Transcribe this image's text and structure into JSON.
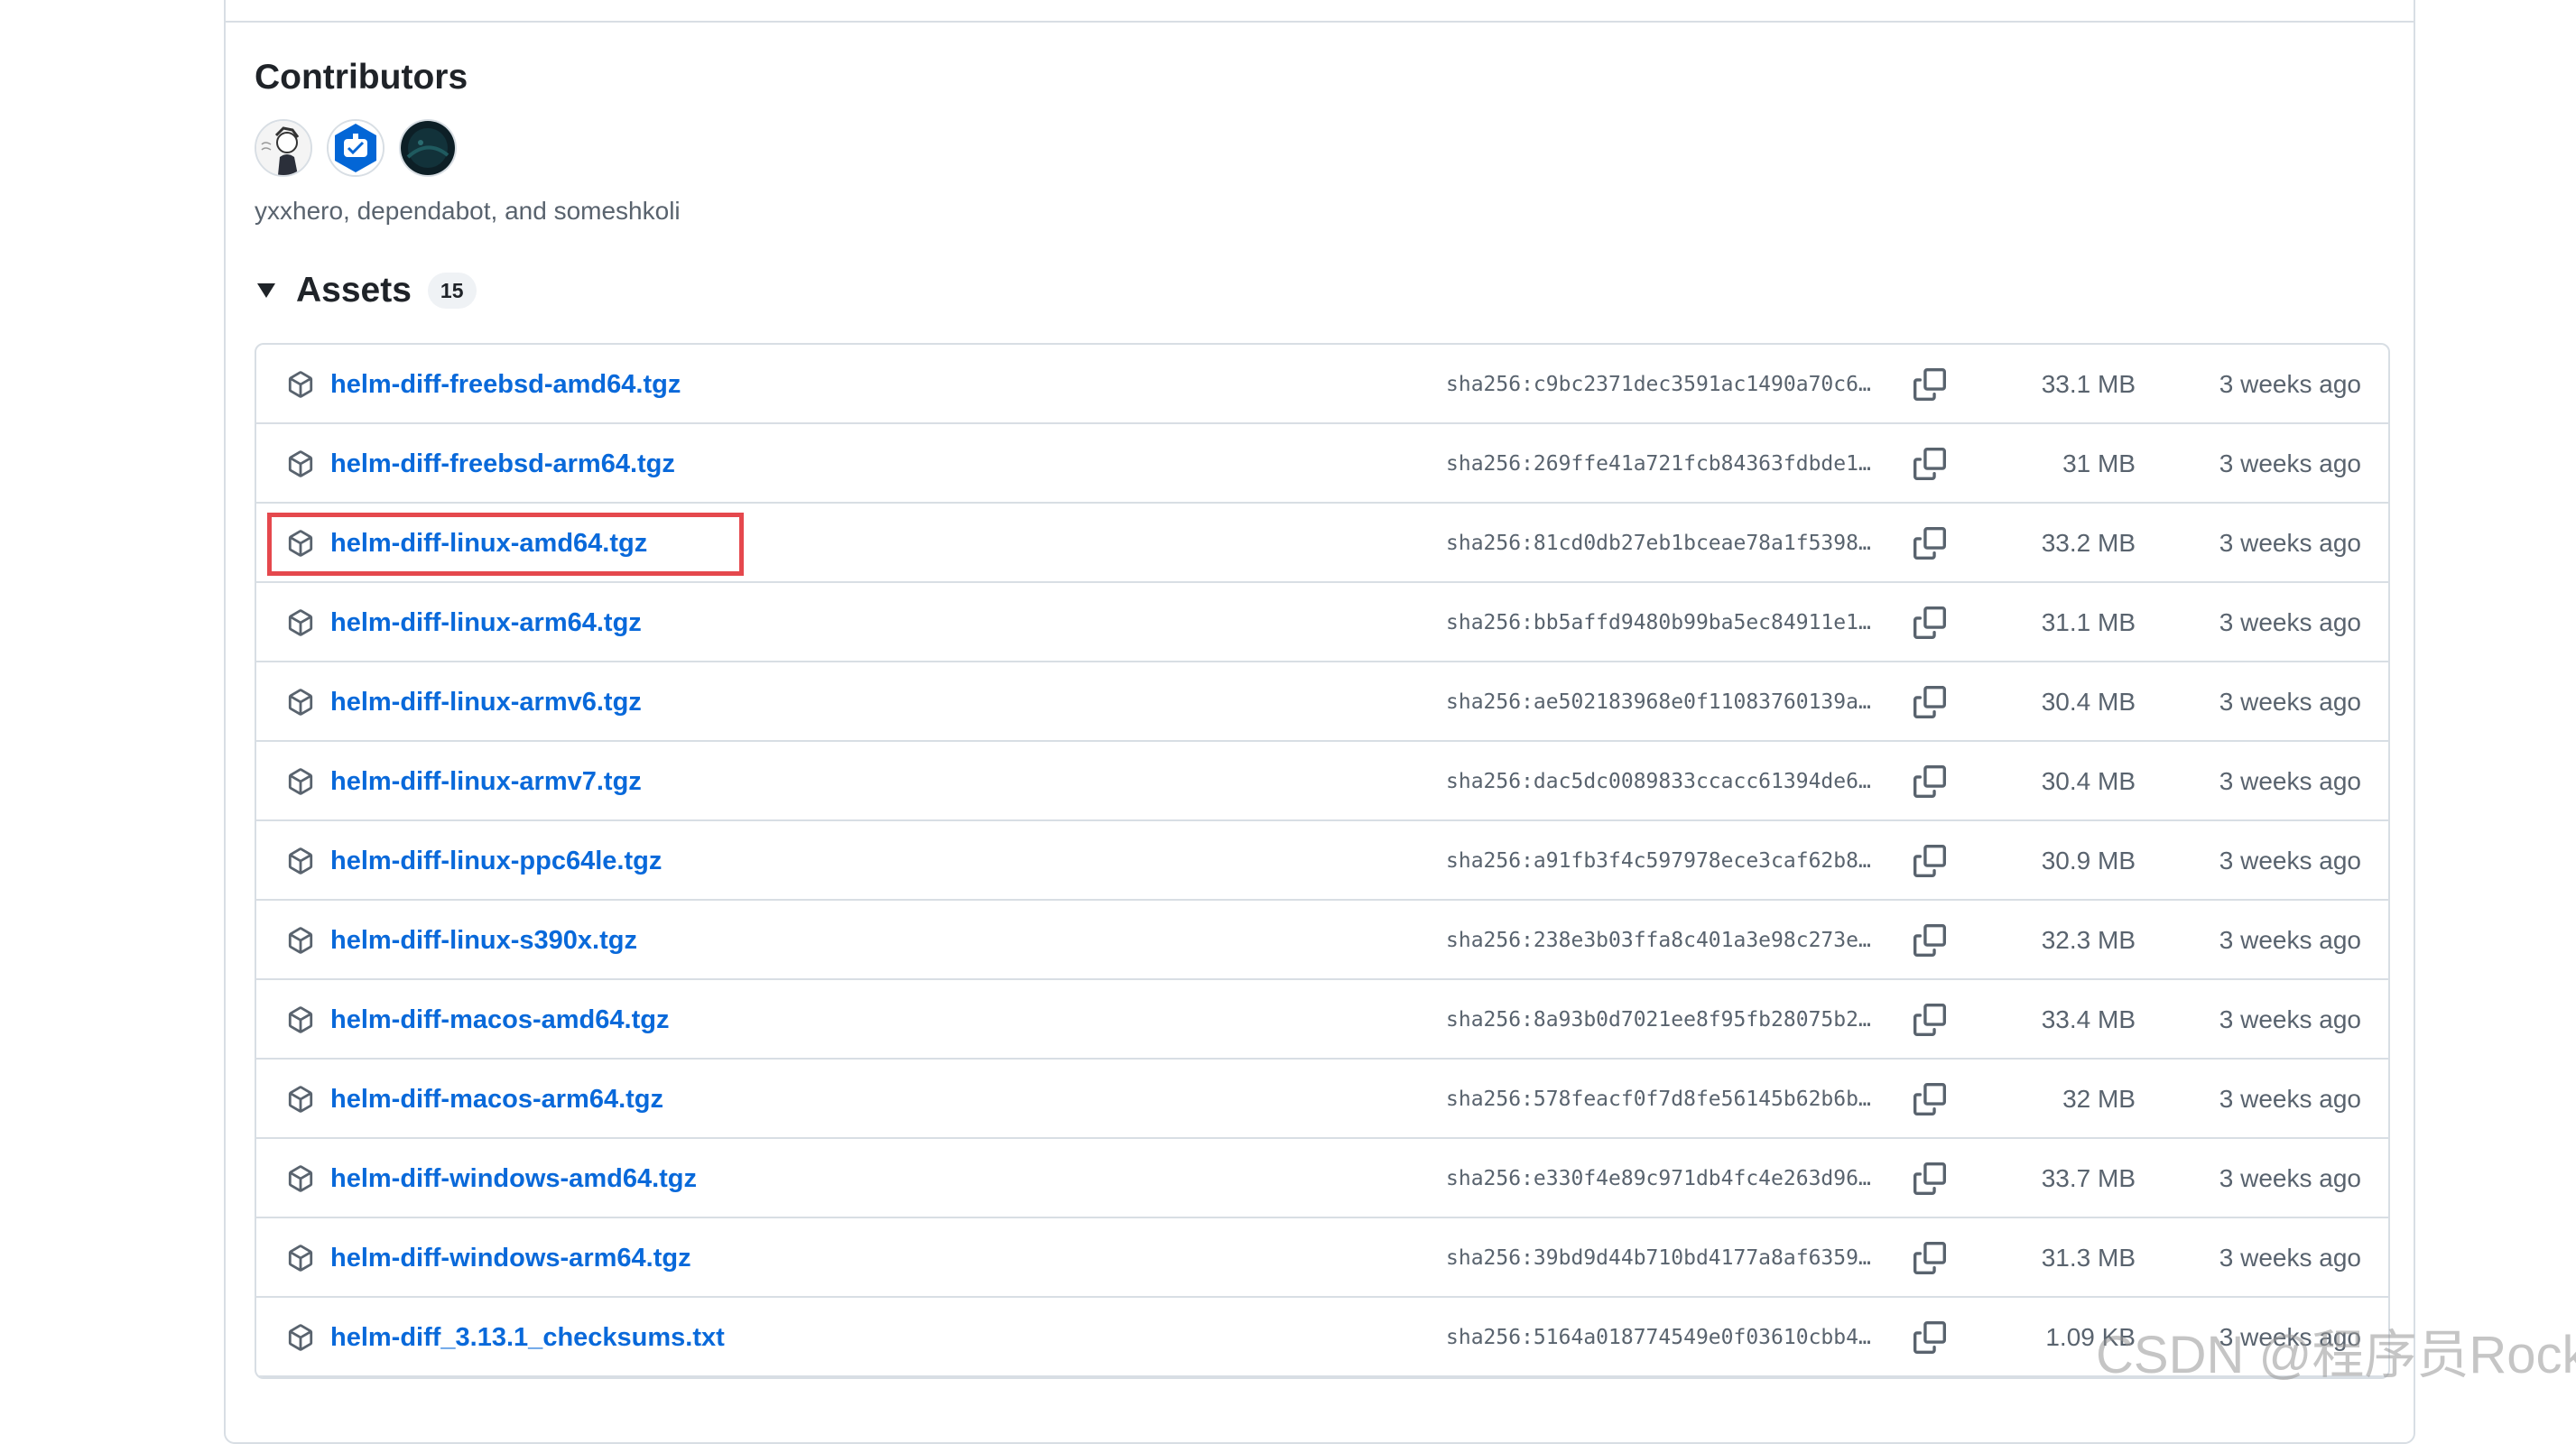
{
  "contributors": {
    "title": "Contributors",
    "names_text": "yxxhero, dependabot, and someshkoli",
    "avatars": [
      "yxxhero",
      "dependabot",
      "someshkoli"
    ]
  },
  "assets": {
    "title": "Assets",
    "count": "15",
    "items": [
      {
        "name": "helm-diff-freebsd-amd64.tgz",
        "hash": "sha256:c9bc2371dec3591ac1490a70c6…",
        "size": "33.1 MB",
        "time": "3 weeks ago"
      },
      {
        "name": "helm-diff-freebsd-arm64.tgz",
        "hash": "sha256:269ffe41a721fcb84363fdbde1…",
        "size": "31 MB",
        "time": "3 weeks ago"
      },
      {
        "name": "helm-diff-linux-amd64.tgz",
        "hash": "sha256:81cd0db27eb1bceae78a1f5398…",
        "size": "33.2 MB",
        "time": "3 weeks ago"
      },
      {
        "name": "helm-diff-linux-arm64.tgz",
        "hash": "sha256:bb5affd9480b99ba5ec84911e1…",
        "size": "31.1 MB",
        "time": "3 weeks ago"
      },
      {
        "name": "helm-diff-linux-armv6.tgz",
        "hash": "sha256:ae502183968e0f11083760139a…",
        "size": "30.4 MB",
        "time": "3 weeks ago"
      },
      {
        "name": "helm-diff-linux-armv7.tgz",
        "hash": "sha256:dac5dc0089833ccacc61394de6…",
        "size": "30.4 MB",
        "time": "3 weeks ago"
      },
      {
        "name": "helm-diff-linux-ppc64le.tgz",
        "hash": "sha256:a91fb3f4c597978ece3caf62b8…",
        "size": "30.9 MB",
        "time": "3 weeks ago"
      },
      {
        "name": "helm-diff-linux-s390x.tgz",
        "hash": "sha256:238e3b03ffa8c401a3e98c273e…",
        "size": "32.3 MB",
        "time": "3 weeks ago"
      },
      {
        "name": "helm-diff-macos-amd64.tgz",
        "hash": "sha256:8a93b0d7021ee8f95fb28075b2…",
        "size": "33.4 MB",
        "time": "3 weeks ago"
      },
      {
        "name": "helm-diff-macos-arm64.tgz",
        "hash": "sha256:578feacf0f7d8fe56145b62b6b…",
        "size": "32 MB",
        "time": "3 weeks ago"
      },
      {
        "name": "helm-diff-windows-amd64.tgz",
        "hash": "sha256:e330f4e89c971db4fc4e263d96…",
        "size": "33.7 MB",
        "time": "3 weeks ago"
      },
      {
        "name": "helm-diff-windows-arm64.tgz",
        "hash": "sha256:39bd9d44b710bd4177a8af6359…",
        "size": "31.3 MB",
        "time": "3 weeks ago"
      },
      {
        "name": "helm-diff_3.13.1_checksums.txt",
        "hash": "sha256:5164a018774549e0f03610cbb4…",
        "size": "1.09 KB",
        "time": "3 weeks ago"
      }
    ]
  },
  "watermark": "CSDN @程序员Rocky",
  "colors": {
    "link": "#0969da",
    "highlight": "#e5484d",
    "muted": "#59636e"
  }
}
